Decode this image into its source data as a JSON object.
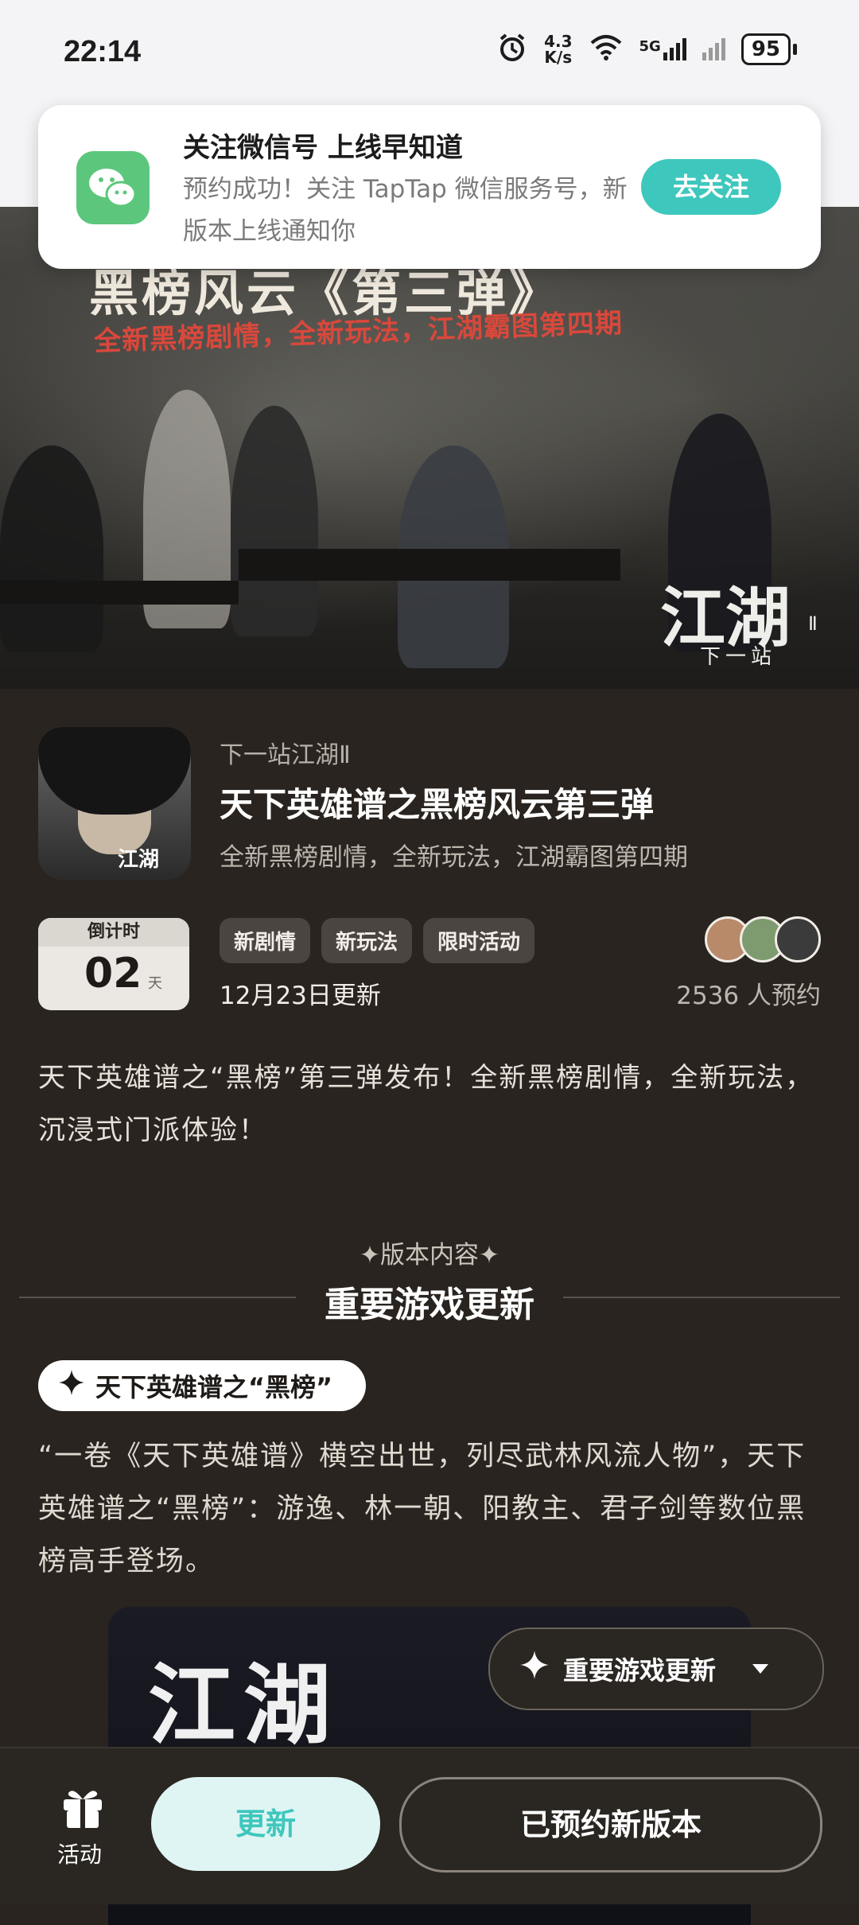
{
  "status_bar": {
    "time": "22:14",
    "net_speed_value": "4.3",
    "net_speed_unit": "K/s",
    "network": "5G",
    "battery": "95"
  },
  "notification": {
    "title": "关注微信号 上线早知道",
    "body": "预约成功！关注 TapTap 微信服务号，新版本上线通知你",
    "button": "去关注",
    "icon": "wechat-icon"
  },
  "hero": {
    "title": "黑榜风云《第三弹》",
    "subtitle": "全新黑榜剧情，全新玩法，江湖霸图第四期",
    "logo": "江湖",
    "logo_mark": "Ⅱ",
    "logo_sub": "下一站"
  },
  "game": {
    "name": "下一站江湖Ⅱ",
    "update_title": "天下英雄谱之黑榜风云第三弹",
    "update_subtitle": "全新黑榜剧情，全新玩法，江湖霸图第四期",
    "icon_text": "江湖"
  },
  "countdown": {
    "label": "倒计时",
    "value": "02",
    "unit": "天"
  },
  "tags": [
    "新剧情",
    "新玩法",
    "限时活动"
  ],
  "update_date": "12月23日更新",
  "reservations": "2536 人预约",
  "intro": "天下英雄谱之“黑榜”第三弹发布！全新黑榜剧情，全新玩法，沉浸式门派体验！",
  "section": {
    "label": "✦版本内容✦",
    "title": "重要游戏更新"
  },
  "feature": {
    "pill": "天下英雄谱之“黑榜”",
    "text": "“一卷《天下英雄谱》横空出世，列尽武林风流人物”，天下英雄谱之“黑榜”：游逸、林一朝、阳教主、君子剑等数位黑榜高手登场。",
    "image_logo": "江湖"
  },
  "float_nav": {
    "label": "重要游戏更新"
  },
  "bottom_bar": {
    "activity_label": "活动",
    "update_button": "更新",
    "reserved_button": "已预约新版本"
  },
  "colors": {
    "accent": "#3ec7bd",
    "background": "#29241f",
    "wechat": "#5cc77c"
  }
}
